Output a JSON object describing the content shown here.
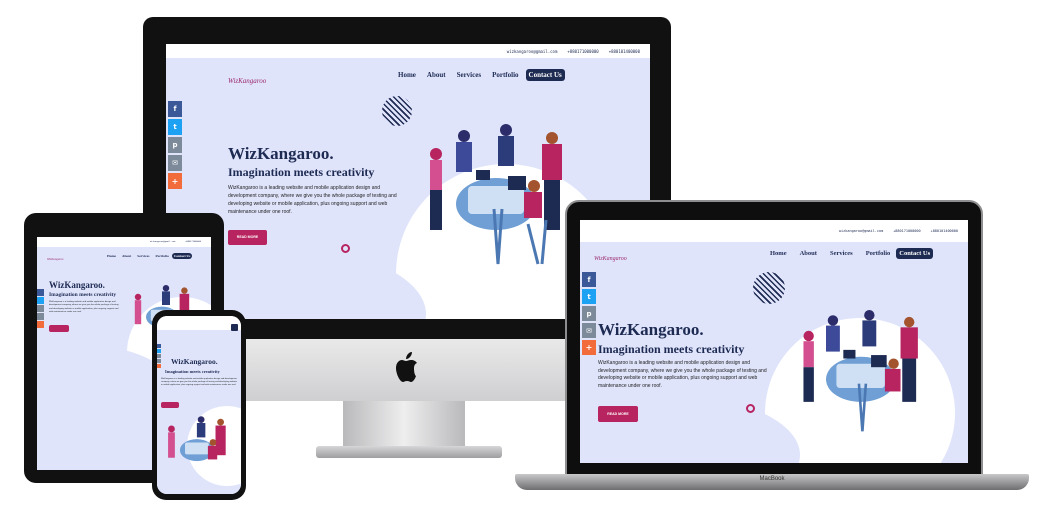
{
  "site": {
    "contact": {
      "email": "wizkangaroo@gmail.com",
      "phone1": "+880171000000",
      "phone2": "+880101400000"
    },
    "logo": "WizKangaroo",
    "nav": [
      "Home",
      "About",
      "Services",
      "Portfolio",
      "Contact Us"
    ],
    "hero_title": "WizKangaroo.",
    "hero_subtitle": "Imagination meets creativity",
    "hero_text": "WizKangaroo is a leading website and mobile application design and development company, where we give you the whole package of testing and developing website or mobile application, plus ongoing support and web maintenance under one roof.",
    "cta": "READ MORE",
    "social": [
      "f",
      "t",
      "p",
      "✉",
      "+"
    ]
  },
  "devices": {
    "laptop_brand": "MacBook"
  },
  "colors": {
    "navy": "#1d2a52",
    "magenta": "#b8245f",
    "hero_bg": "#dfe4fb"
  },
  "icons": {
    "apple": "apple-logo-icon"
  }
}
